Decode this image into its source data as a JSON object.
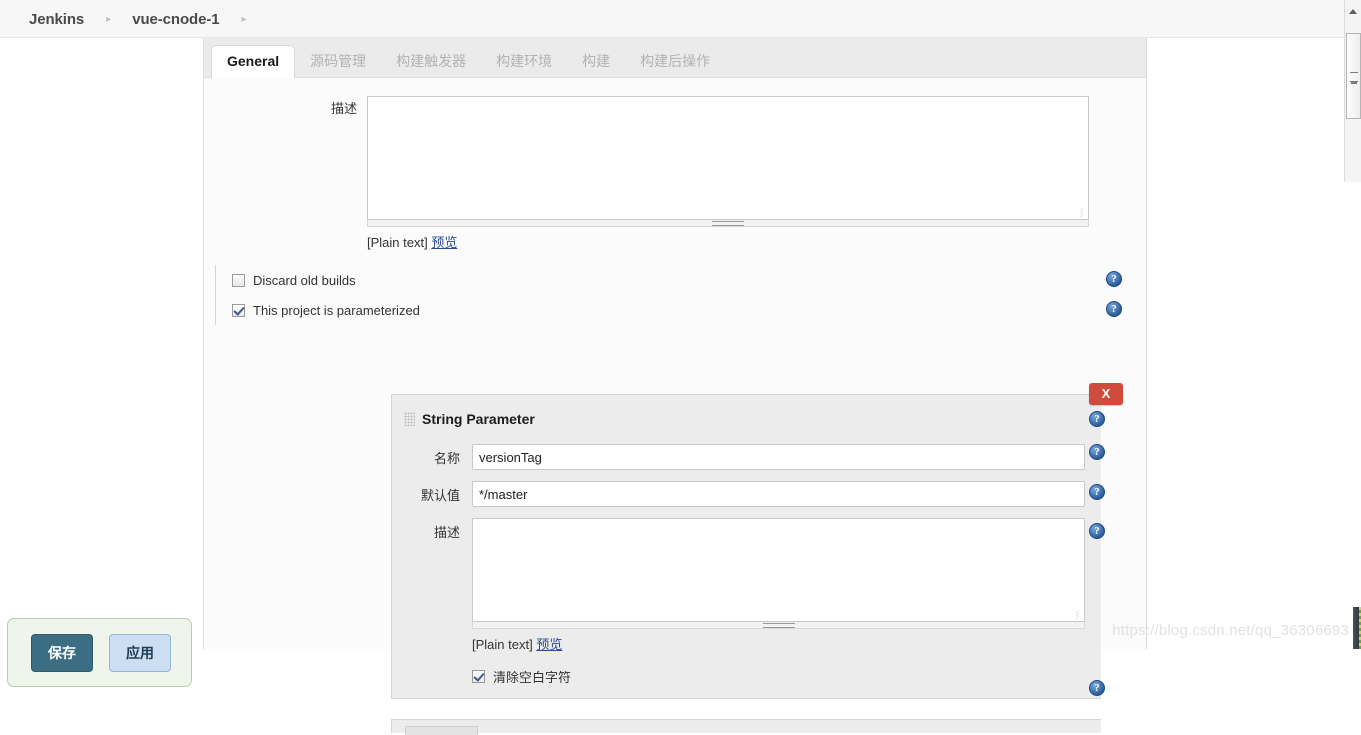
{
  "breadcrumb": {
    "items": [
      {
        "label": "Jenkins"
      },
      {
        "label": "vue-cnode-1"
      }
    ],
    "separator": "▸"
  },
  "tabs": [
    {
      "label": "General",
      "active": true
    },
    {
      "label": "源码管理",
      "active": false
    },
    {
      "label": "构建触发器",
      "active": false
    },
    {
      "label": "构建环境",
      "active": false
    },
    {
      "label": "构建",
      "active": false
    },
    {
      "label": "构建后操作",
      "active": false
    }
  ],
  "general": {
    "description_label": "描述",
    "description_value": "",
    "plain_text_label": "[Plain text]",
    "preview_link": "预览",
    "checkboxes": [
      {
        "label": "Discard old builds",
        "checked": false
      },
      {
        "label": "This project is parameterized",
        "checked": true
      }
    ]
  },
  "string_parameter": {
    "title": "String Parameter",
    "delete_label": "X",
    "name_label": "名称",
    "name_value": "versionTag",
    "default_label": "默认值",
    "default_value": "*/master",
    "description_label": "描述",
    "description_value": "",
    "plain_text_label": "[Plain text]",
    "preview_link": "预览",
    "trim_label": "清除空白字符",
    "trim_checked": true,
    "grip_name": "drag-handle",
    "help_glyph": "?"
  },
  "footer": {
    "save_label": "保存",
    "apply_label": "应用"
  },
  "watermark": "https://blog.csdn.net/qq_36306693",
  "colors": {
    "accent_save": "#3b6e82",
    "accent_apply": "#ccdff2",
    "delete_red": "#cf4b3c",
    "help_blue": "#2b5c9b",
    "savebar_bg": "#f0f5ec"
  }
}
